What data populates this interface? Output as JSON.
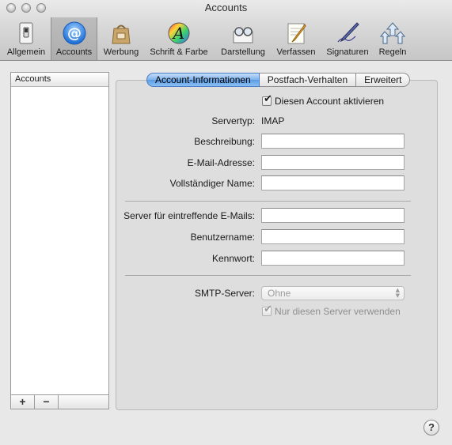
{
  "window": {
    "title": "Accounts"
  },
  "toolbar": {
    "items": [
      {
        "label": "Allgemein",
        "icon": "general-switch-icon"
      },
      {
        "label": "Accounts",
        "icon": "at-sign-icon",
        "selected": true
      },
      {
        "label": "Werbung",
        "icon": "junk-mail-bag-icon"
      },
      {
        "label": "Schrift & Farbe",
        "icon": "fonts-colors-icon"
      },
      {
        "label": "Darstellung",
        "icon": "viewing-glasses-icon"
      },
      {
        "label": "Verfassen",
        "icon": "compose-pencil-icon"
      },
      {
        "label": "Signaturen",
        "icon": "signature-pen-icon"
      },
      {
        "label": "Regeln",
        "icon": "rules-arrows-icon"
      }
    ]
  },
  "sidebar": {
    "header": "Accounts",
    "add_label": "+",
    "remove_label": "−"
  },
  "tabs": [
    {
      "label": "Account-Informationen",
      "active": true
    },
    {
      "label": "Postfach-Verhalten",
      "active": false
    },
    {
      "label": "Erweitert",
      "active": false
    }
  ],
  "form": {
    "enable_account_label": "Diesen Account aktivieren",
    "enable_account_checked": true,
    "server_type_label": "Servertyp:",
    "server_type_value": "IMAP",
    "description_label": "Beschreibung:",
    "description_value": "",
    "email_label": "E-Mail-Adresse:",
    "email_value": "",
    "fullname_label": "Vollständiger Name:",
    "fullname_value": "",
    "incoming_server_label": "Server für eintreffende E-Mails:",
    "incoming_server_value": "",
    "username_label": "Benutzername:",
    "username_value": "",
    "password_label": "Kennwort:",
    "password_value": "",
    "smtp_label": "SMTP-Server:",
    "smtp_value": "Ohne",
    "only_this_server_label": "Nur diesen Server verwenden",
    "only_this_server_checked": true
  },
  "help_label": "?"
}
